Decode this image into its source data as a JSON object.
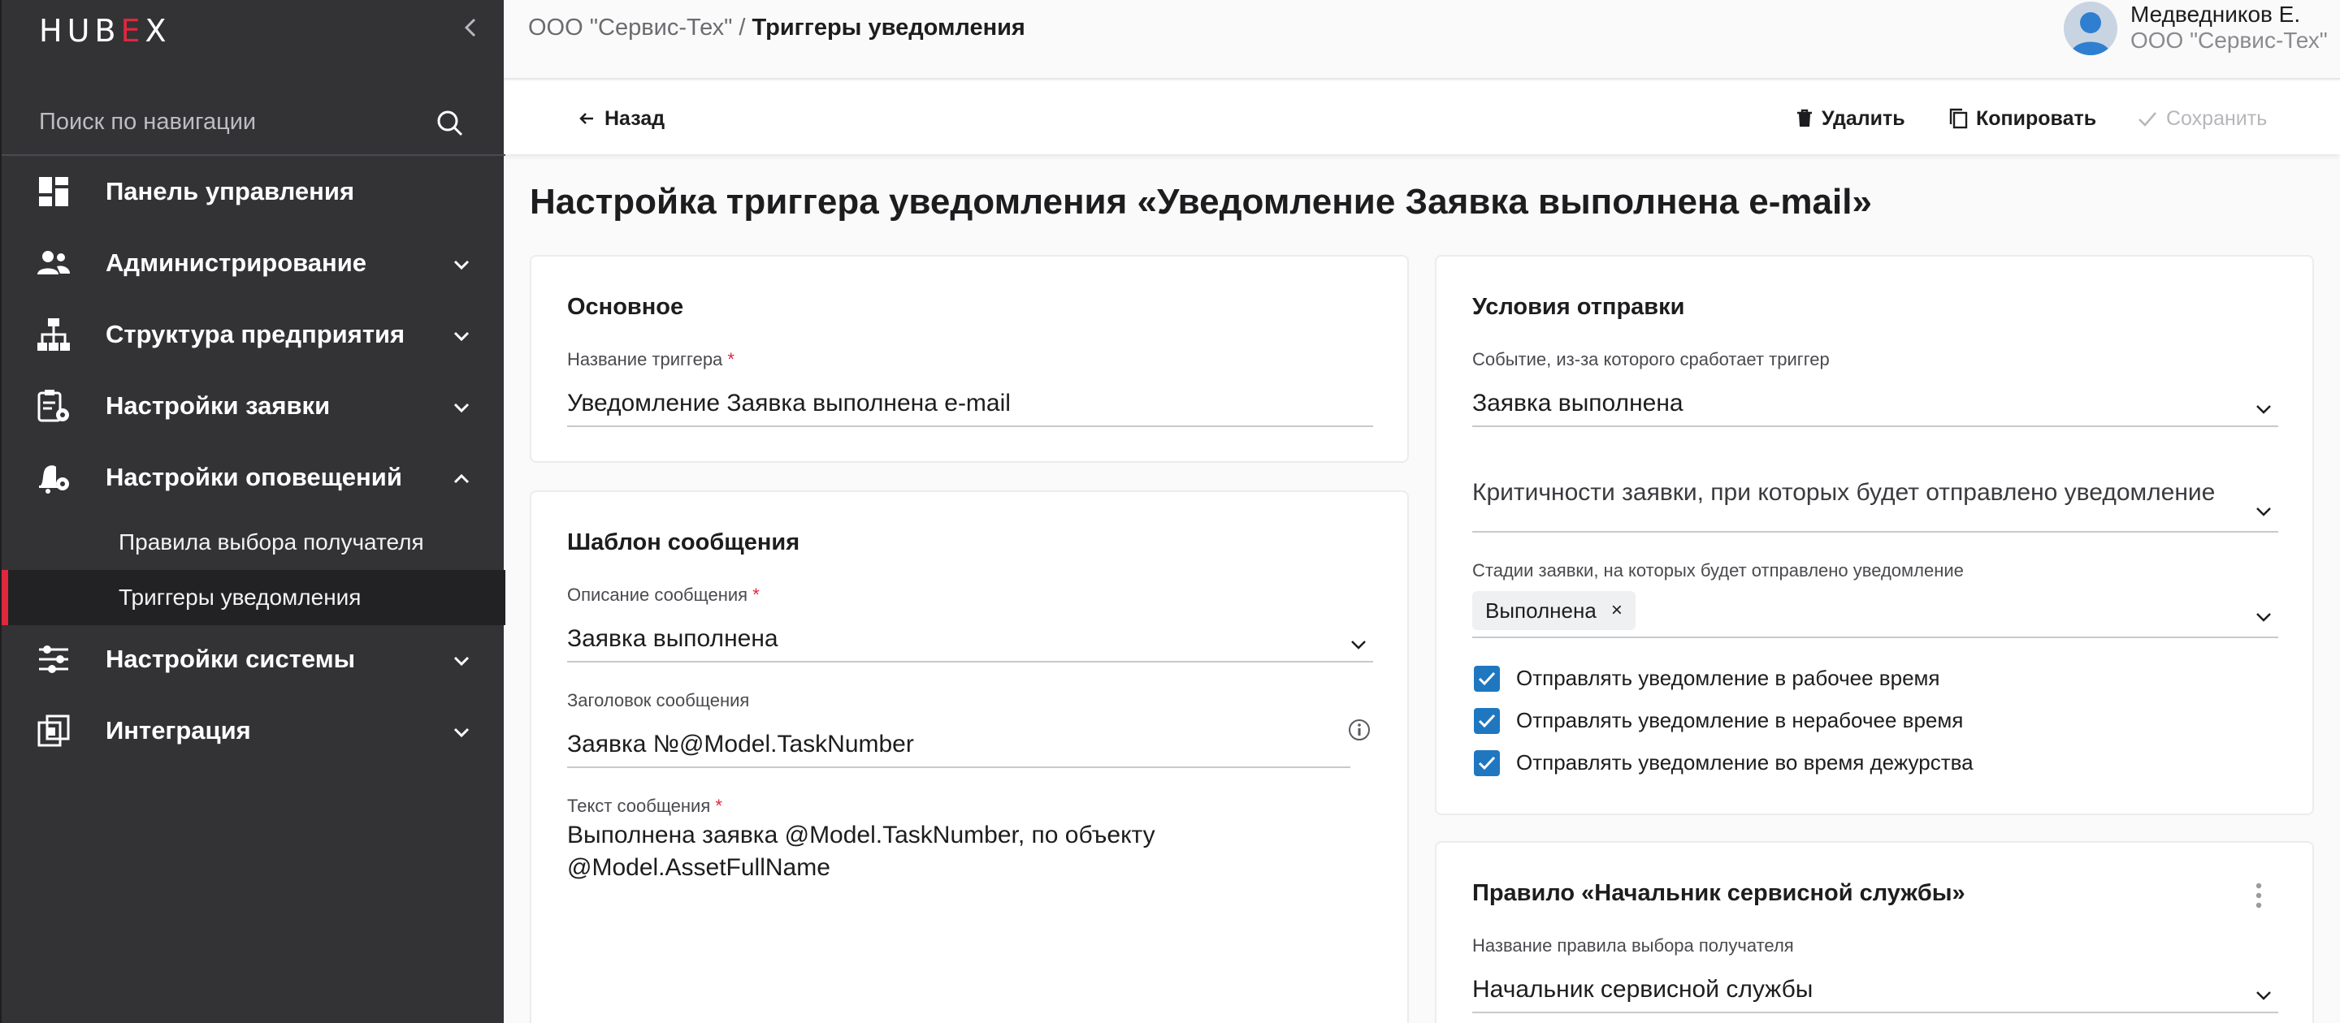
{
  "sidebar": {
    "logo": {
      "pre": "HUB",
      "accent": "E",
      "post": "X"
    },
    "search_placeholder": "Поиск по навигации",
    "items": [
      {
        "label": "Панель управления"
      },
      {
        "label": "Администрирование"
      },
      {
        "label": "Структура предприятия"
      },
      {
        "label": "Настройки заявки"
      },
      {
        "label": "Настройки оповещений"
      },
      {
        "label": "Настройки системы"
      },
      {
        "label": "Интеграция"
      }
    ],
    "subitems": [
      {
        "label": "Правила выбора получателя"
      },
      {
        "label": "Триггеры уведомления"
      }
    ]
  },
  "header": {
    "breadcrumb_org": "ООО \"Сервис-Тех\"",
    "breadcrumb_sep": " / ",
    "breadcrumb_current": "Триггеры уведомления",
    "user_name": "Медведников Е.",
    "user_org": "ООО \"Сервис-Тех\""
  },
  "actions": {
    "back": "Назад",
    "delete": "Удалить",
    "copy": "Копировать",
    "save": "Сохранить"
  },
  "page_title": "Настройка триггера уведомления «Уведомление Заявка выполнена e-mail»",
  "basic": {
    "title": "Основное",
    "name_label": "Название триггера",
    "name_value": "Уведомление Заявка выполнена e-mail"
  },
  "template": {
    "title": "Шаблон сообщения",
    "desc_label": "Описание сообщения",
    "desc_value": "Заявка выполнена",
    "subject_label": "Заголовок сообщения",
    "subject_value": "Заявка №@Model.TaskNumber",
    "body_label": "Текст сообщения",
    "body_line1": "Выполнена заявка @Model.TaskNumber, по объекту",
    "body_line2": "@Model.AssetFullName"
  },
  "conditions": {
    "title": "Условия отправки",
    "event_label": "Событие, из-за которого сработает триггер",
    "event_value": "Заявка выполнена",
    "criticality_placeholder": "Критичности заявки, при которых будет отправлено уведомление",
    "stages_label": "Стадии заявки, на которых будет отправлено уведомление",
    "stage_chip": "Выполнена",
    "chip_remove": "×",
    "checkboxes": [
      {
        "label": "Отправлять уведомление в рабочее время",
        "checked": true
      },
      {
        "label": "Отправлять уведомление в нерабочее время",
        "checked": true
      },
      {
        "label": "Отправлять уведомление во время дежурства",
        "checked": true
      }
    ]
  },
  "rule": {
    "title": "Правило «Начальник сервисной службы»",
    "name_label": "Название правила выбора получателя",
    "name_value": "Начальник сервисной службы"
  },
  "colors": {
    "accent": "#e0273d",
    "checkbox": "#1f77c0",
    "sidebar": "#333336"
  }
}
